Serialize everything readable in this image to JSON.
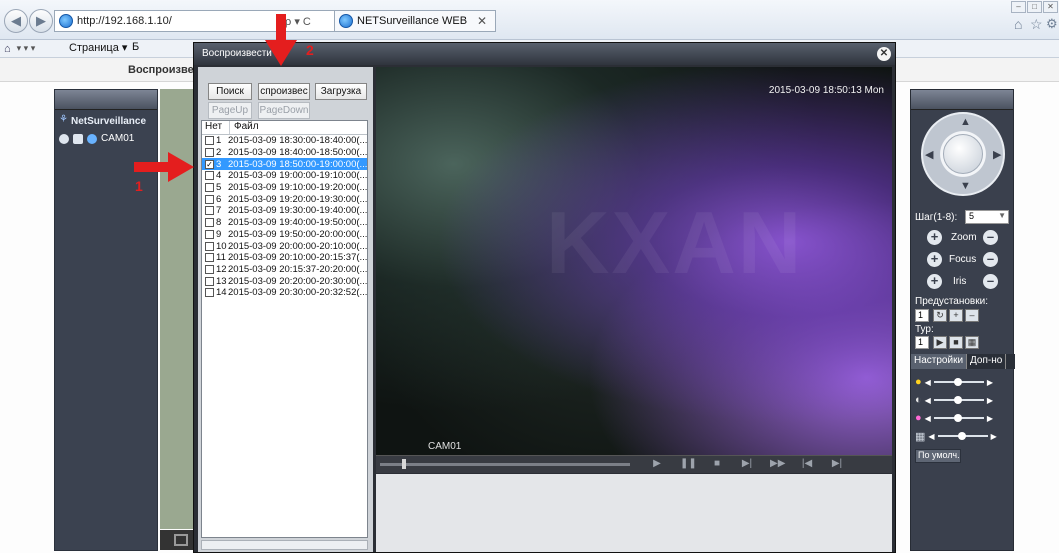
{
  "browser": {
    "url": "http://192.168.1.10/",
    "tab_title": "NETSurveillance WEB",
    "address_controls": "ρ ▾ C",
    "menu_page": "Страница ▾",
    "menu_b": "Б",
    "menu_prefix_icons": "▾   ▾   ▾"
  },
  "page": {
    "header_title": "Воспроизведе",
    "left_panel": {
      "device": "NetSurveillance",
      "camera": "CAM01"
    },
    "ptz": {
      "step_label": "Шаг(1-8):",
      "step_value": "5",
      "zoom": "Zoom",
      "focus": "Focus",
      "iris": "Iris",
      "presets_label": "Предустановки:",
      "preset_value": "1",
      "tour_label": "Тур:",
      "tour_value": "1",
      "tabs": [
        "Настройки",
        "Доп-но"
      ],
      "default_button": "По умолч."
    }
  },
  "dialog": {
    "title": "Воспроизвести",
    "buttons": {
      "search": "Поиск",
      "play": "спроизвес",
      "download": "Загрузка",
      "page_up": "PageUp",
      "page_down": "PageDown"
    },
    "list": {
      "col_no": "Нет",
      "col_file": "Файл",
      "rows": [
        {
          "no": "1",
          "file": "2015-03-09 18:30:00-18:40:00(...",
          "checked": false
        },
        {
          "no": "2",
          "file": "2015-03-09 18:40:00-18:50:00(...",
          "checked": false
        },
        {
          "no": "3",
          "file": "2015-03-09 18:50:00-19:00:00(...",
          "checked": true
        },
        {
          "no": "4",
          "file": "2015-03-09 19:00:00-19:10:00(...",
          "checked": false
        },
        {
          "no": "5",
          "file": "2015-03-09 19:10:00-19:20:00(...",
          "checked": false
        },
        {
          "no": "6",
          "file": "2015-03-09 19:20:00-19:30:00(...",
          "checked": false
        },
        {
          "no": "7",
          "file": "2015-03-09 19:30:00-19:40:00(...",
          "checked": false
        },
        {
          "no": "8",
          "file": "2015-03-09 19:40:00-19:50:00(...",
          "checked": false
        },
        {
          "no": "9",
          "file": "2015-03-09 19:50:00-20:00:00(...",
          "checked": false
        },
        {
          "no": "10",
          "file": "2015-03-09 20:00:00-20:10:00(...",
          "checked": false
        },
        {
          "no": "11",
          "file": "2015-03-09 20:10:00-20:15:37(...",
          "checked": false
        },
        {
          "no": "12",
          "file": "2015-03-09 20:15:37-20:20:00(...",
          "checked": false
        },
        {
          "no": "13",
          "file": "2015-03-09 20:20:00-20:30:00(...",
          "checked": false
        },
        {
          "no": "14",
          "file": "2015-03-09 20:30:00-20:32:52(...",
          "checked": false
        }
      ],
      "selected_no": "3"
    },
    "video": {
      "timestamp": "2015-03-09 18:50:13 Mon",
      "camera": "CAM01",
      "watermark": "KXAN"
    }
  },
  "annotations": {
    "step1": "1",
    "step2": "2"
  },
  "colors": {
    "annotation": "#e41e1e",
    "selection": "#3399ff"
  }
}
